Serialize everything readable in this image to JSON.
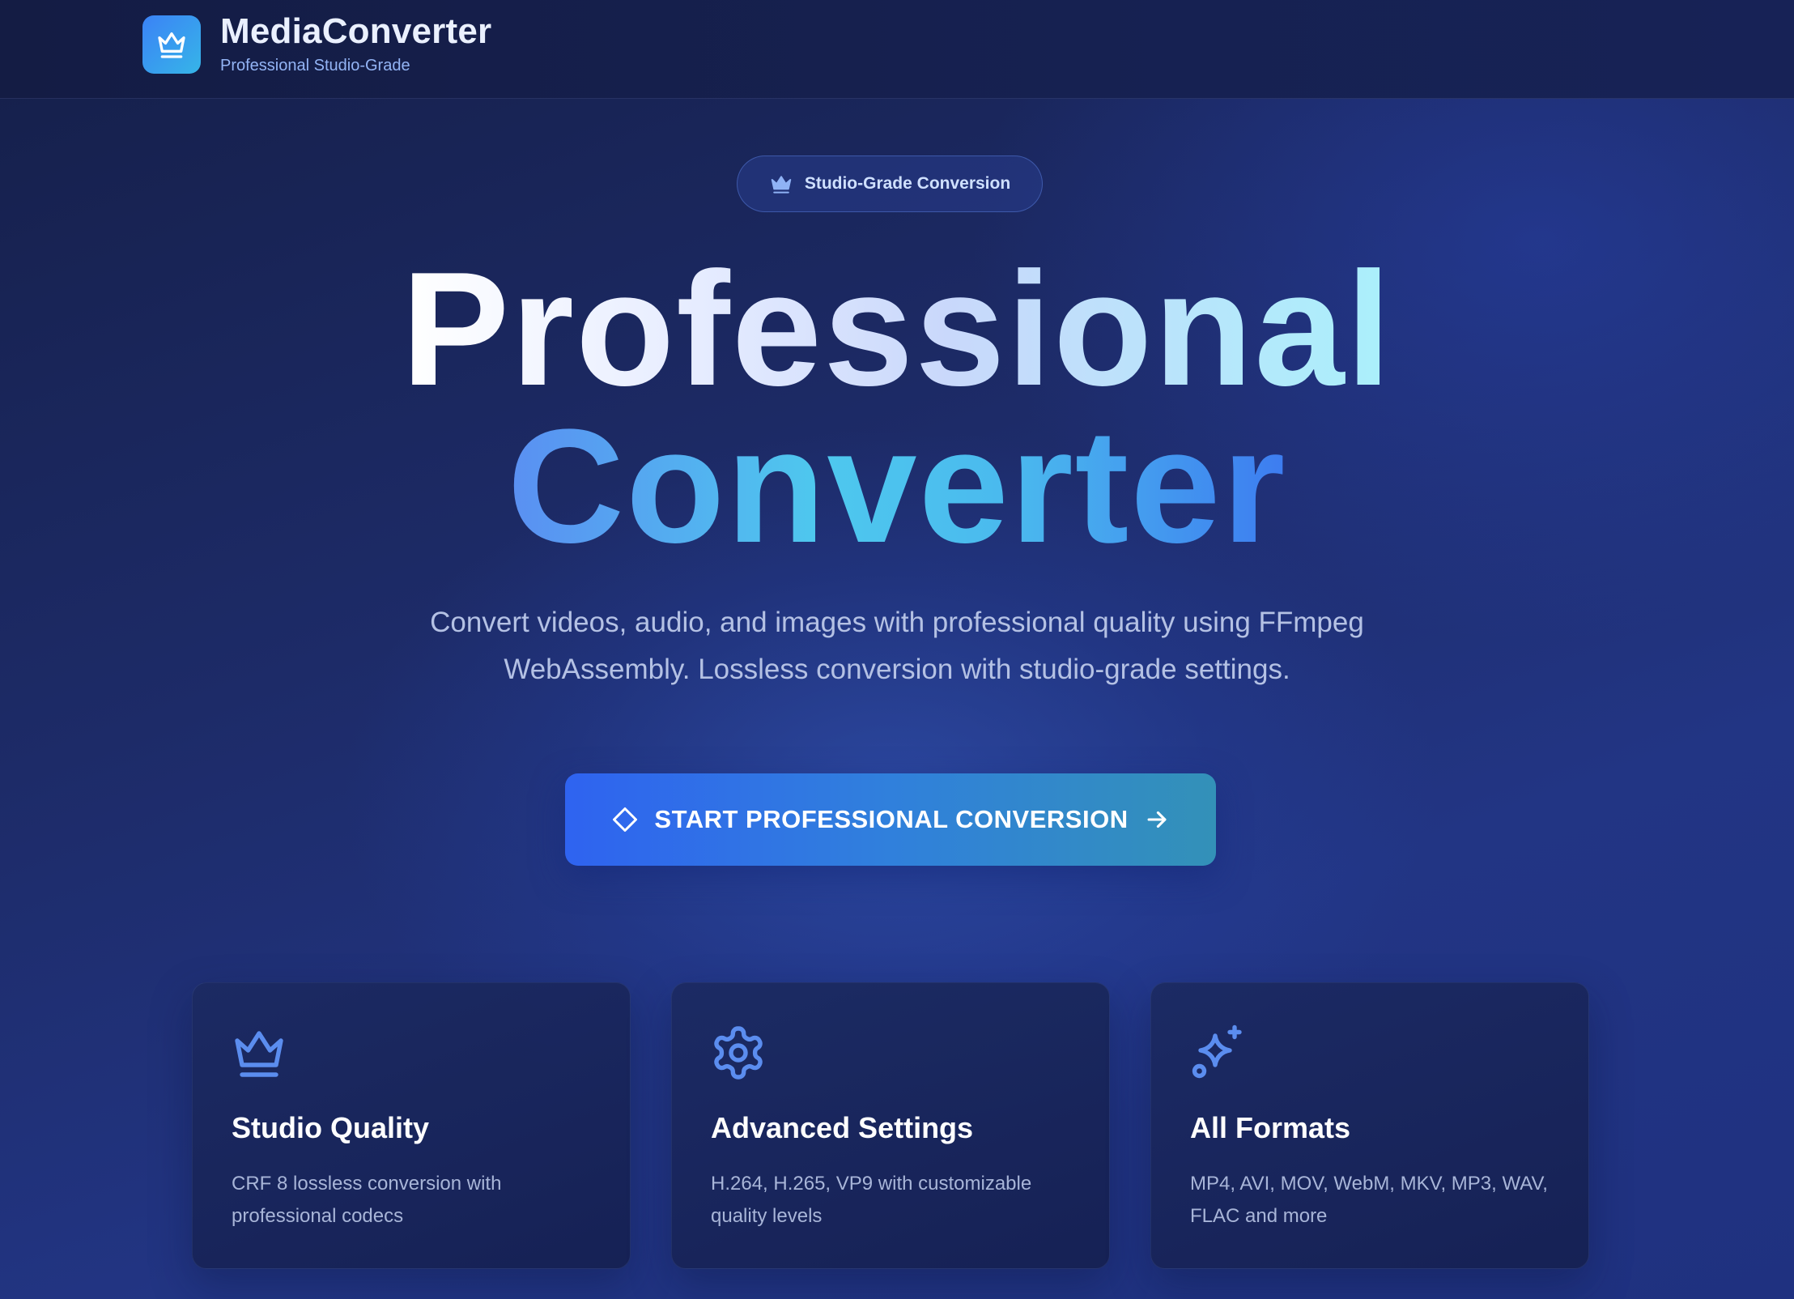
{
  "header": {
    "brand_name": "MediaConverter",
    "brand_subtitle": "Professional Studio-Grade",
    "logo_icon": "crown-icon"
  },
  "badge": {
    "label": "Studio-Grade Conversion",
    "icon": "crown-icon"
  },
  "hero": {
    "title_line1": "Professional",
    "title_line2": "Converter",
    "description_line1": "Convert videos, audio, and images with professional quality using FFmpeg",
    "description_line2": "WebAssembly. Lossless conversion with studio-grade settings."
  },
  "cta": {
    "label": "START PROFESSIONAL CONVERSION",
    "leading_icon": "diamond-icon",
    "trailing_icon": "arrow-right-icon"
  },
  "features": [
    {
      "icon": "crown-icon",
      "title": "Studio Quality",
      "description": "CRF 8 lossless conversion with professional codecs"
    },
    {
      "icon": "gear-icon",
      "title": "Advanced Settings",
      "description": "H.264, H.265, VP9 with customizable quality levels"
    },
    {
      "icon": "sparkles-icon",
      "title": "All Formats",
      "description": "MP4, AVI, MOV, WebM, MKV, MP3, WAV, FLAC and more"
    }
  ],
  "colors": {
    "accent_blue": "#3b82f6",
    "accent_cyan": "#4ec8ee",
    "icon_blue": "#5b8def",
    "background": "#1c2a63"
  }
}
